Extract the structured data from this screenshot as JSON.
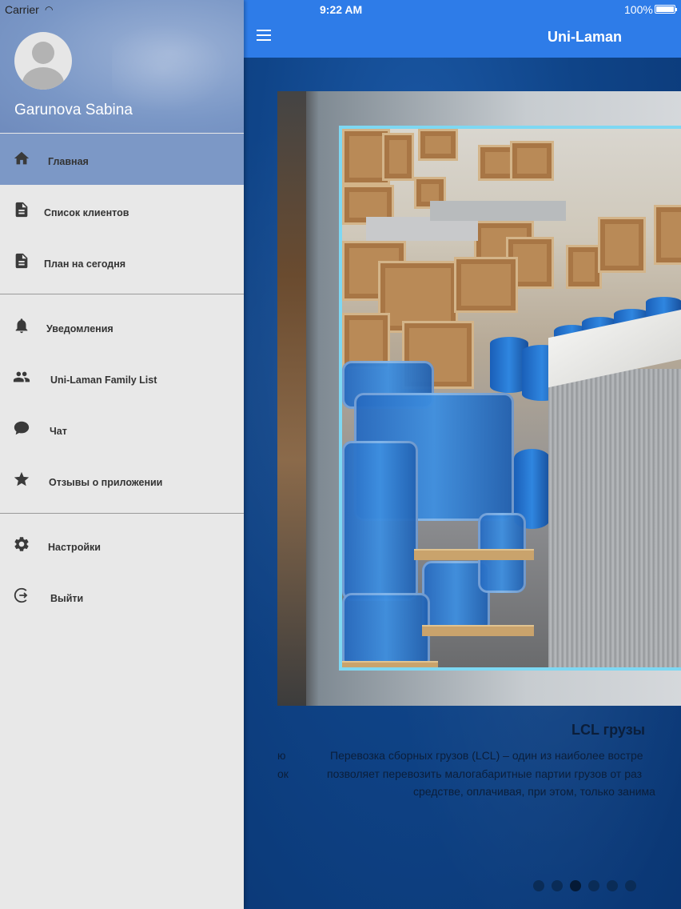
{
  "status_bar": {
    "carrier": "Carrier",
    "time": "9:22 AM",
    "battery": "100%"
  },
  "app_bar": {
    "title": "Uni-Laman"
  },
  "drawer": {
    "user_name": "Garunova Sabina",
    "items": [
      {
        "label": "Главная",
        "icon": "home-icon",
        "active": true
      },
      {
        "label": "Список клиентов",
        "icon": "document-icon"
      },
      {
        "label": "План на сегодня",
        "icon": "document-icon"
      },
      {
        "label": "Уведомления",
        "icon": "bell-icon"
      },
      {
        "label": "Uni-Laman Family List",
        "icon": "people-icon"
      },
      {
        "label": "Чат",
        "icon": "chat-icon"
      },
      {
        "label": "Отзывы о приложении",
        "icon": "star-icon"
      },
      {
        "label": "Настройки",
        "icon": "gear-icon"
      },
      {
        "label": "Выйти",
        "icon": "logout-icon"
      }
    ]
  },
  "slide": {
    "title": "LCL грузы",
    "lines": [
      "Перевозка сборных грузов (LCL) – один из наиболее востре",
      "позволяет перевозить малогабаритные партии грузов от раз",
      "средстве, оплачивая, при этом, только занима"
    ],
    "prev_fragments": [
      "ю",
      "ок"
    ]
  },
  "pager": {
    "count": 6,
    "active_index": 2
  },
  "colors": {
    "app_bar": "#2e7ce8",
    "drawer_active": "#7c98c6",
    "photo_border": "#7ed8f3"
  }
}
